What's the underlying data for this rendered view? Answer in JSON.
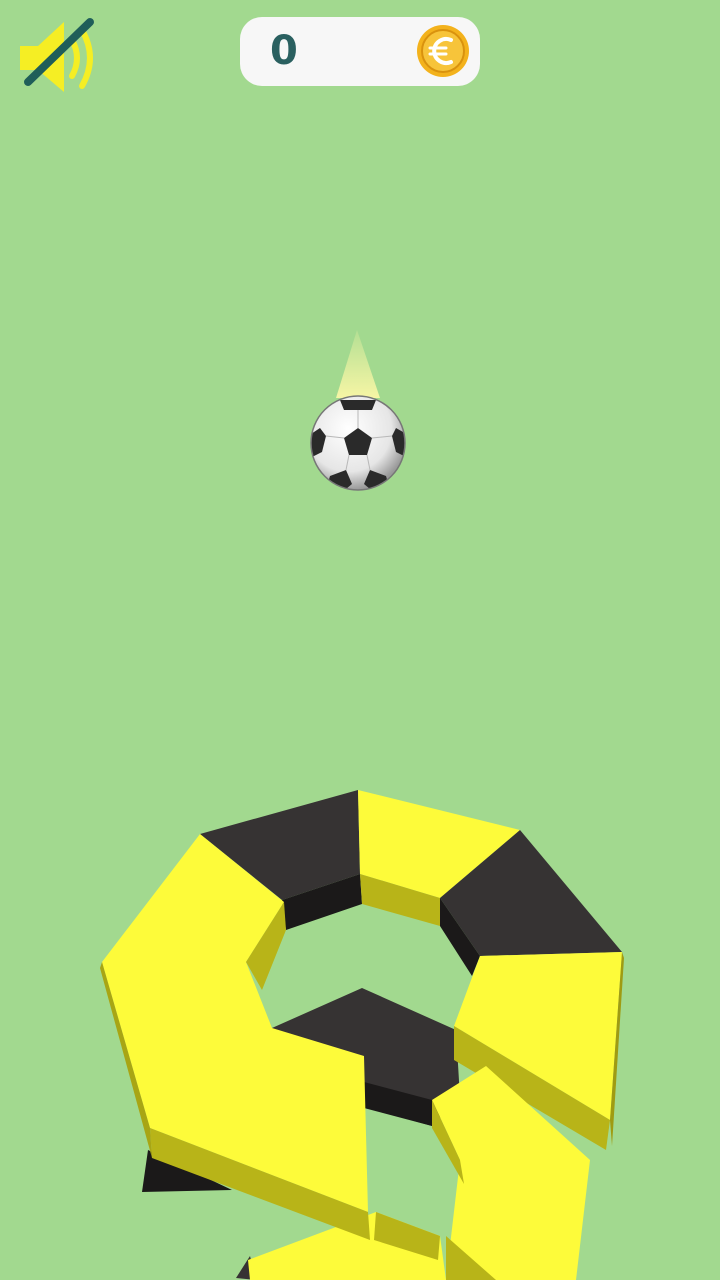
{
  "hud": {
    "score": "0",
    "sound_icon": "speaker-muted-icon",
    "currency_icon": "euro-coin-icon"
  },
  "colors": {
    "background": "#a2d98f",
    "yellow_top": "#fdfb3a",
    "yellow_side": "#b8b418",
    "black_top": "#363333",
    "black_side": "#1b1919",
    "score_text": "#2a6060",
    "coin": "#f3b21c",
    "speaker": "#f5ee24",
    "mute_slash": "#1f5e59"
  }
}
